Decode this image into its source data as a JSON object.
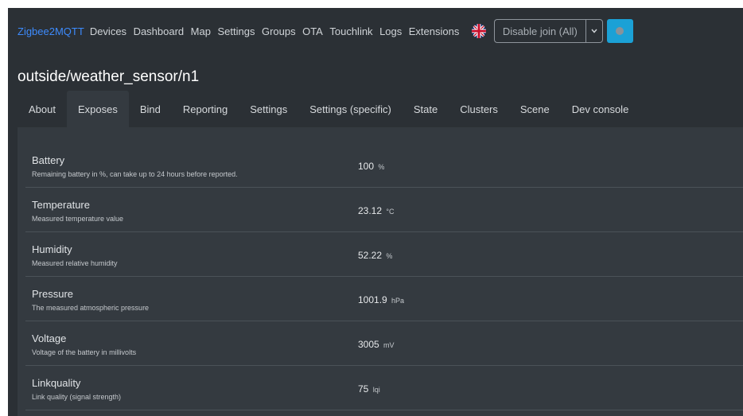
{
  "navbar": {
    "brand": "Zigbee2MQTT",
    "links": [
      "Devices",
      "Dashboard",
      "Map",
      "Settings",
      "Groups",
      "OTA",
      "Touchlink",
      "Logs",
      "Extensions"
    ],
    "language_icon": "uk-flag-icon",
    "join_button_label": "Disable join (All)",
    "join_caret_icon": "chevron-down-icon",
    "permit_button_icon": "circle-icon",
    "colors": {
      "brand": "#3d8bfd",
      "permit_button": "#1ba1d6"
    }
  },
  "device": {
    "title": "outside/weather_sensor/n1"
  },
  "tabs": [
    "About",
    "Exposes",
    "Bind",
    "Reporting",
    "Settings",
    "Settings (specific)",
    "State",
    "Clusters",
    "Scene",
    "Dev console"
  ],
  "active_tab": "Exposes",
  "exposes": [
    {
      "label": "Battery",
      "description": "Remaining battery in %, can take up to 24 hours before reported.",
      "value": "100",
      "unit": "%"
    },
    {
      "label": "Temperature",
      "description": "Measured temperature value",
      "value": "23.12",
      "unit": "°C"
    },
    {
      "label": "Humidity",
      "description": "Measured relative humidity",
      "value": "52.22",
      "unit": "%"
    },
    {
      "label": "Pressure",
      "description": "The measured atmospheric pressure",
      "value": "1001.9",
      "unit": "hPa"
    },
    {
      "label": "Voltage",
      "description": "Voltage of the battery in millivolts",
      "value": "3005",
      "unit": "mV"
    },
    {
      "label": "Linkquality",
      "description": "Link quality (signal strength)",
      "value": "75",
      "unit": "lqi"
    }
  ]
}
